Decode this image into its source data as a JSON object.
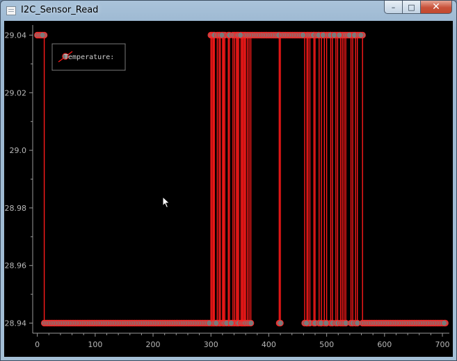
{
  "window": {
    "title": "I2C_Sensor_Read",
    "buttons": [
      {
        "name": "minimize-button",
        "icon": "minimize-icon",
        "glyph": "–"
      },
      {
        "name": "maximize-button",
        "icon": "maximize-icon",
        "glyph": "□"
      },
      {
        "name": "close-button",
        "icon": "close-icon",
        "glyph": "✕"
      }
    ]
  },
  "chart_data": {
    "type": "line",
    "title": "",
    "xlabel": "",
    "ylabel": "",
    "xlim": [
      -8,
      712
    ],
    "ylim": [
      28.9365,
      29.0435
    ],
    "xticks": [
      0,
      100,
      200,
      300,
      400,
      500,
      600,
      700
    ],
    "yticks": [
      28.94,
      28.96,
      28.98,
      29.0,
      29.02,
      29.04
    ],
    "ytick_labels": [
      "28.94",
      "28.96",
      "28.98",
      "29.0",
      "29.02",
      "29.04"
    ],
    "grid": false,
    "background": "#000000",
    "line_color": "#ff1a1a",
    "marker_fill": "#7a7a7a",
    "marker_edge": "#ff2020",
    "axis_color": "#9a9a9a",
    "legend": {
      "position": "top-left",
      "entries": [
        "Temperature:"
      ]
    },
    "series": [
      {
        "name": "Temperature:",
        "low": 28.94,
        "high": 29.04,
        "x_range": [
          0,
          705
        ],
        "high_segments": [
          [
            0,
            12
          ],
          [
            300,
            302
          ],
          [
            304,
            306
          ],
          [
            311,
            314
          ],
          [
            316,
            320
          ],
          [
            322,
            324
          ],
          [
            330,
            332
          ],
          [
            338,
            341
          ],
          [
            344,
            346
          ],
          [
            348,
            352
          ],
          [
            354,
            356
          ],
          [
            358,
            360
          ],
          [
            363,
            366
          ],
          [
            369,
            418
          ],
          [
            420,
            462
          ],
          [
            466,
            468
          ],
          [
            471,
            478
          ],
          [
            480,
            487
          ],
          [
            491,
            496
          ],
          [
            500,
            507
          ],
          [
            510,
            516
          ],
          [
            519,
            524
          ],
          [
            527,
            530
          ],
          [
            533,
            542
          ],
          [
            545,
            550
          ],
          [
            553,
            562
          ]
        ]
      }
    ]
  }
}
